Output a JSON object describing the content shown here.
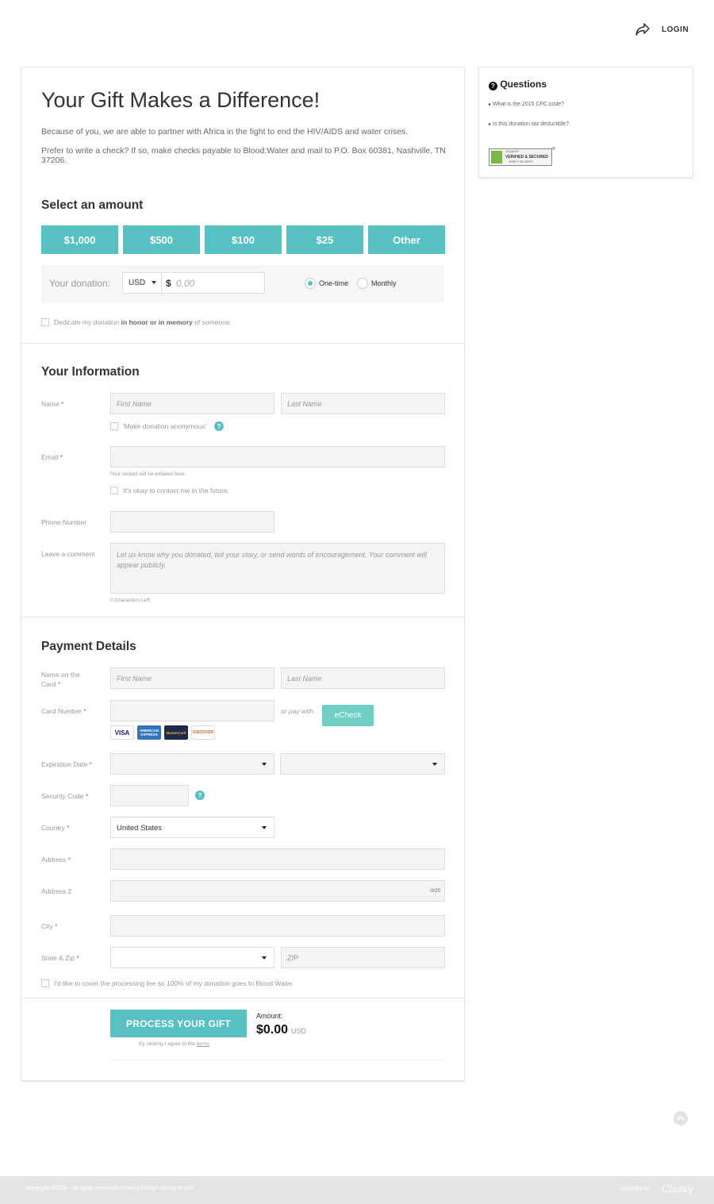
{
  "header": {
    "login_label": "LOGIN"
  },
  "form": {
    "title": "Your Gift Makes a Difference!",
    "intro1": "Because of you, we are able to partner with Africa in the fight to end the HIV/AIDS and water crises.",
    "intro2": "Prefer to write a check? If so, make checks payable to Blood:Water and mail to P.O. Box 60381, Nashville, TN 37206.",
    "amount_section": {
      "title": "Select an amount",
      "buttons": [
        "$1,000",
        "$500",
        "$100",
        "$25",
        "Other"
      ],
      "donation_label": "Your donation:",
      "currency": "USD",
      "currency_symbol": "$",
      "amount_placeholder": "0.00",
      "frequency": [
        {
          "label": "One-time",
          "selected": true
        },
        {
          "label": "Monthly",
          "selected": false
        }
      ],
      "dedicate_prefix": "Dedicate my donation ",
      "dedicate_bold": "in honor or in memory",
      "dedicate_suffix": " of someone"
    },
    "info_section": {
      "title": "Your Information",
      "name_label": "Name",
      "first_name_placeholder": "First Name",
      "last_name_placeholder": "Last Name",
      "anonymous_label": "'Make donation anonymous'",
      "email_label": "Email",
      "email_hint": "Your receipt will be emailed here.",
      "contact_label": "It's okay to contact me in the future.",
      "phone_label": "Phone Number",
      "comment_label": "Leave a comment",
      "comment_placeholder": "Let us know why you donated, tell your story, or send words of encouragement. Your comment will appear publicly.",
      "chars_left": "0 Characters Left"
    },
    "payment_section": {
      "title": "Payment Details",
      "name_on_card_line1": "Name on the",
      "name_on_card_line2": "Card",
      "first_name_placeholder": "First Name",
      "last_name_placeholder": "Last Name",
      "card_number_label": "Card Number",
      "or_pay_with": "or pay with",
      "echeck_label": "eCheck",
      "card_logos": [
        "VISA",
        "AMERICAN EXPRESS",
        "MasterCard",
        "DISCOVER"
      ],
      "expiration_label": "Expiration Date",
      "security_label": "Security Code",
      "country_label": "Country",
      "country_value": "United States",
      "address_label": "Address",
      "address2_label": "Address 2",
      "address2_counter": "0/25",
      "city_label": "City",
      "state_zip_label": "State & Zip",
      "zip_placeholder": "ZIP",
      "cover_fee_label": "I'd like to cover the processing fee so 100% of my donation goes to Blood:Water."
    },
    "submit": {
      "button_label": "PROCESS YOUR GIFT",
      "agree_prefix": "By clicking I agree to the ",
      "terms_label": "terms",
      "amount_label": "Amount:",
      "amount_value": "$0.00",
      "amount_currency": "USD"
    },
    "required_marker": "*"
  },
  "sidebar": {
    "title": "Questions",
    "items": [
      "What is the 2015 CFC code?",
      "Is this donation tax deductible?"
    ],
    "badge_line1": "GODADDY",
    "badge_line2": "VERIFIED & SECURED",
    "badge_line3": "VERIFY SECURITY"
  },
  "footer": {
    "copyright": "Copyright ©2018 - All rights reserved • Privacy Policy • Terms of Use",
    "powered_by": "POWERED BY",
    "brand": "Classy"
  },
  "colors": {
    "accent": "#56c0c3",
    "echeck": "#6ecfc2",
    "required": "#e25555",
    "footer": "#e4e4e4"
  }
}
